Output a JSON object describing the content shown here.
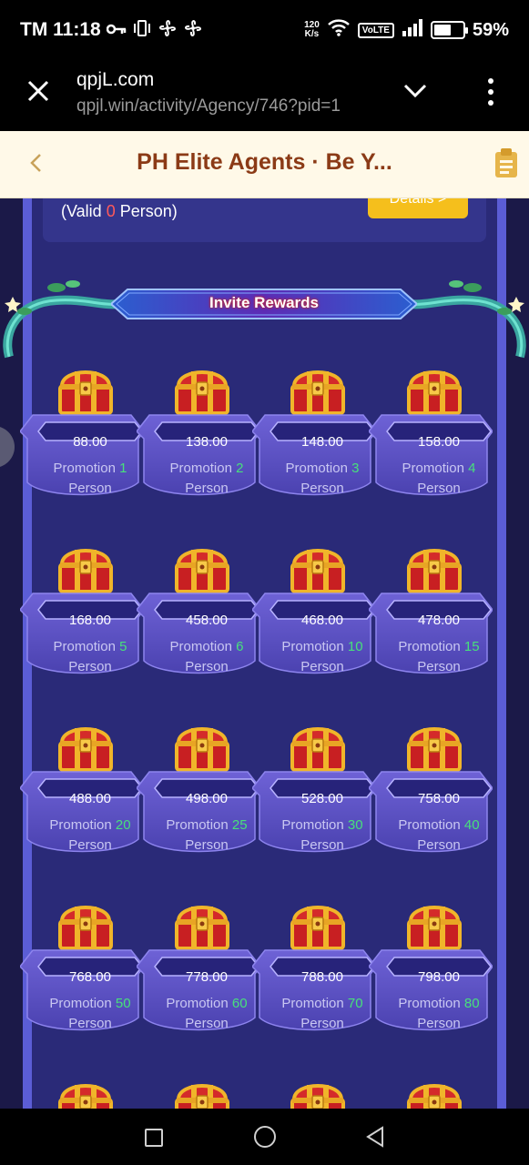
{
  "status_bar": {
    "carrier_time": "TM 11:18",
    "net_speed_top": "120",
    "net_speed_bottom": "K/s",
    "volte": "VoLTE",
    "battery_pct": "59%",
    "battery_level": 0.59
  },
  "browser": {
    "title": "qpjL.com",
    "url": "qpjl.win/activity/Agency/746?pid=1"
  },
  "header": {
    "title": "PH Elite Agents · Be Y..."
  },
  "valid_summary": {
    "prefix": "(Valid ",
    "count": "0",
    "suffix": " Person)",
    "details_label": "Details >"
  },
  "invite_rewards": {
    "title": "Invite Rewards",
    "promotion_label": "Promotion",
    "person_label": "Person",
    "rewards": [
      {
        "amount": "88.00",
        "count": "1"
      },
      {
        "amount": "138.00",
        "count": "2"
      },
      {
        "amount": "148.00",
        "count": "3"
      },
      {
        "amount": "158.00",
        "count": "4"
      },
      {
        "amount": "168.00",
        "count": "5"
      },
      {
        "amount": "458.00",
        "count": "6"
      },
      {
        "amount": "468.00",
        "count": "10"
      },
      {
        "amount": "478.00",
        "count": "15"
      },
      {
        "amount": "488.00",
        "count": "20"
      },
      {
        "amount": "498.00",
        "count": "25"
      },
      {
        "amount": "528.00",
        "count": "30"
      },
      {
        "amount": "758.00",
        "count": "40"
      },
      {
        "amount": "768.00",
        "count": "50"
      },
      {
        "amount": "778.00",
        "count": "60"
      },
      {
        "amount": "788.00",
        "count": "70"
      },
      {
        "amount": "798.00",
        "count": "80"
      }
    ]
  },
  "colors": {
    "background": "#1b1948",
    "panel": "#2a2a78",
    "rail": "#5b5dd6",
    "header_bg": "#fff9e8",
    "title": "#8b3a16",
    "count_highlight": "#48e07b",
    "valid_count": "#ff5a5a",
    "details_button": "#f5bf1c"
  },
  "icons": {
    "close": "close-icon",
    "chevron": "chevron-down-icon",
    "more": "more-vertical-icon",
    "back": "chevron-left-icon",
    "clipboard": "clipboard-icon",
    "chest": "treasure-chest-icon"
  }
}
